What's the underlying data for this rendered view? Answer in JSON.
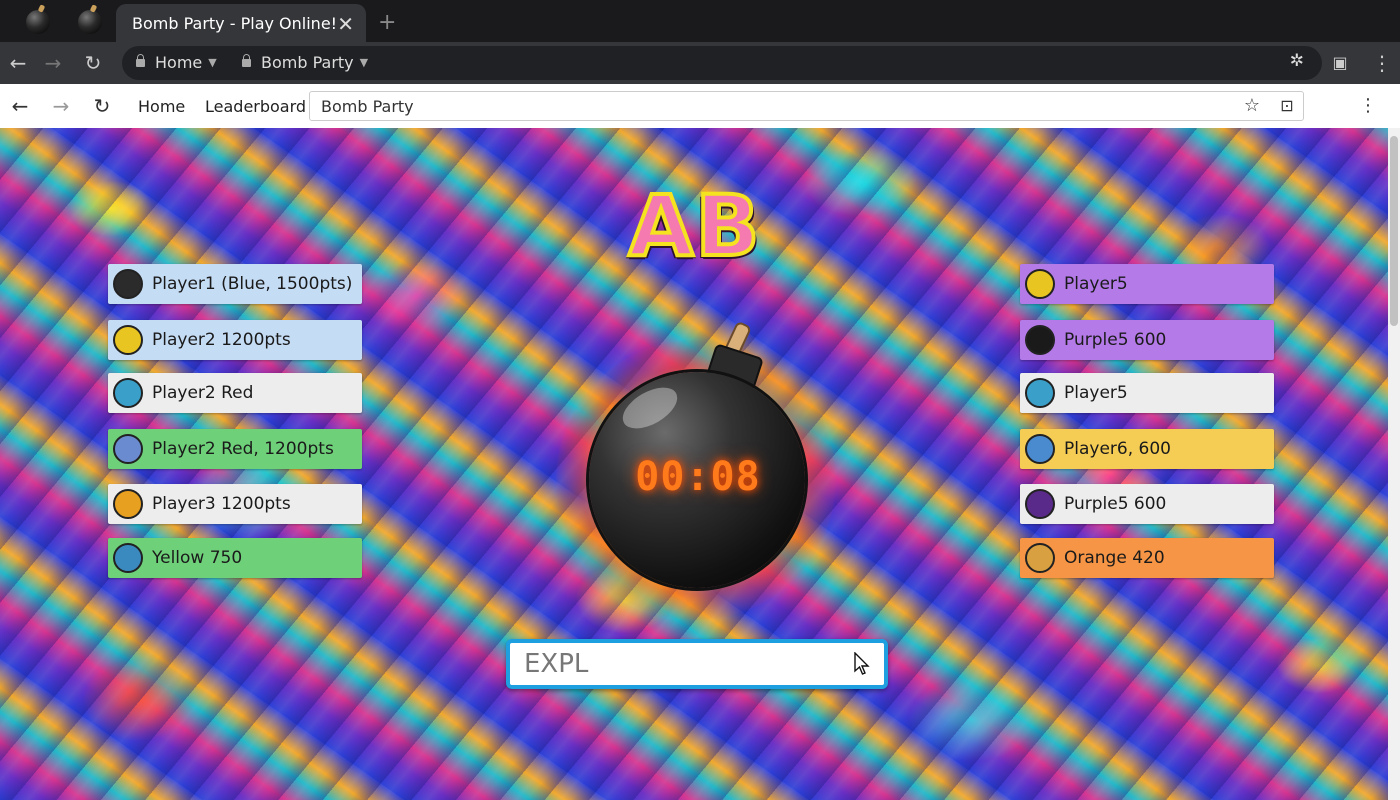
{
  "browser": {
    "active_tab_title": "Bomb Party - Play Online!",
    "close_tab": "✕",
    "new_tab": "+",
    "omnibox": {
      "crumbs": [
        {
          "label": "Home"
        },
        {
          "label": "Bomb Party"
        }
      ]
    }
  },
  "site_nav": {
    "links": [
      "Home",
      "Leaderboard"
    ],
    "address_value": "Bomb Party"
  },
  "game": {
    "prompt": "AB",
    "timer": "00:08",
    "answer_value": "EXPL",
    "players_left": [
      {
        "label": "Player1 (Blue, 1500pts)",
        "color": "#c5dcf5",
        "avatar": "#2b2b2b"
      },
      {
        "label": "Player2 1200pts",
        "color": "#c5dcf5",
        "avatar": "#e8c520"
      },
      {
        "label": "Player2 Red",
        "color": "#ededed",
        "avatar": "#3aa0c9"
      },
      {
        "label": "Player2 Red, 1200pts",
        "color": "#6fd07a",
        "avatar": "#6a8bd0"
      },
      {
        "label": "Player3 1200pts",
        "color": "#ededed",
        "avatar": "#e8a020"
      },
      {
        "label": "Yellow 750",
        "color": "#6fd07a",
        "avatar": "#3a8ac0"
      }
    ],
    "players_right": [
      {
        "label": "Player5",
        "color": "#b47ae8",
        "avatar": "#e8c520"
      },
      {
        "label": "Purple5 600",
        "color": "#b47ae8",
        "avatar": "#1a1a1a"
      },
      {
        "label": "Player5",
        "color": "#ededed",
        "avatar": "#3aa0c9"
      },
      {
        "label": "Player6, 600",
        "color": "#f5cd55",
        "avatar": "#4a8bd0"
      },
      {
        "label": "Purple5 600",
        "color": "#ededed",
        "avatar": "#5a2a8a"
      },
      {
        "label": "Orange 420",
        "color": "#f59545",
        "avatar": "#d8a040"
      }
    ]
  }
}
